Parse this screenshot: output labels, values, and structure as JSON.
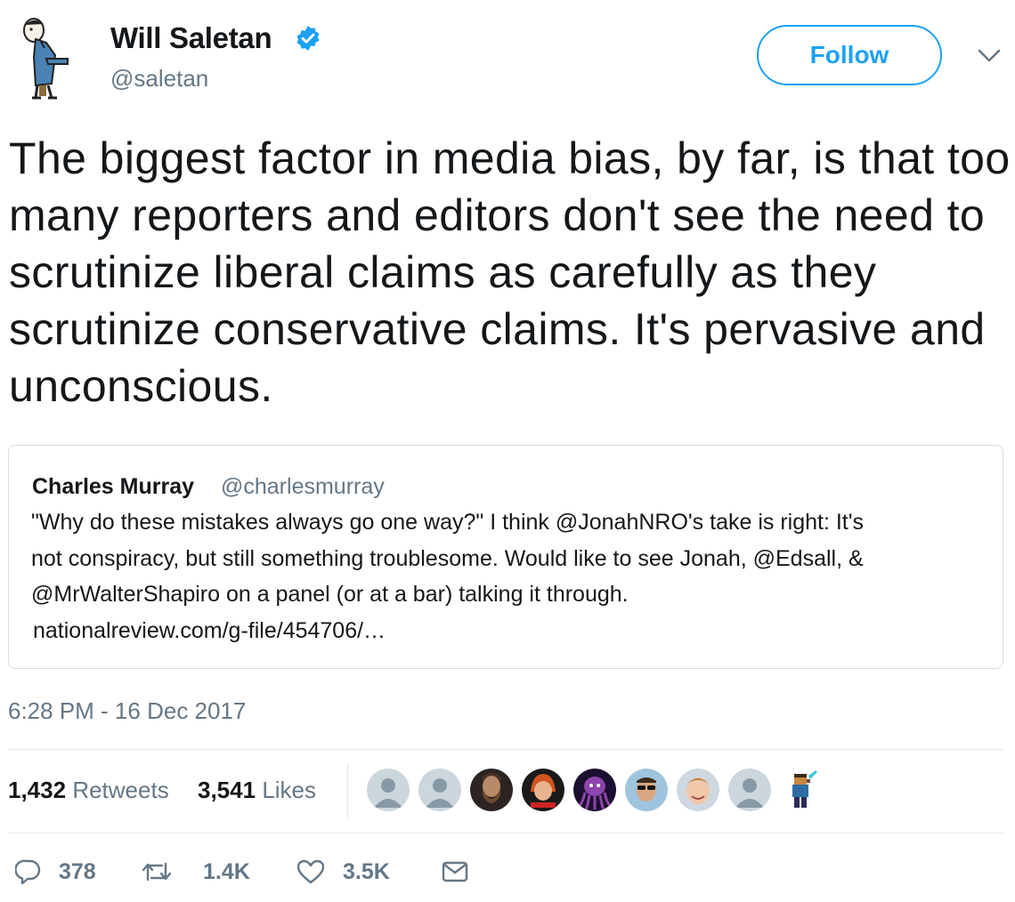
{
  "author": {
    "name": "Will Saletan",
    "handle": "@saletan",
    "verified_icon": "verified-badge-icon",
    "avatar_icon": "cartoon-man-avatar"
  },
  "follow_label": "Follow",
  "tweet_text": "The biggest factor in media bias, by far, is that too many reporters and editors don't see the need to scrutinize liberal claims as carefully as they scrutinize conservative claims. It's pervasive and unconscious.",
  "quoted_tweet": {
    "name": "Charles Murray",
    "handle": "@charlesmurray",
    "lines": [
      "\"Why do these mistakes always go one way?\" I think @JonahNRO's take is right: It's",
      "not conspiracy, but still something troublesome. Would like to see Jonah, @Edsall, &",
      "@MrWalterShapiro on a panel (or at a bar) talking it through."
    ],
    "link": "nationalreview.com/g-file/454706/…"
  },
  "timestamp": "6:28 PM - 16 Dec 2017",
  "stats": {
    "retweets_count": "1,432",
    "retweets_label": "Retweets",
    "likes_count": "3,541",
    "likes_label": "Likes"
  },
  "liker_avatars": [
    "default-avatar",
    "default-avatar",
    "bearded-man-avatar",
    "redhead-avatar",
    "purple-octopus-avatar",
    "sunglasses-man-avatar",
    "smiling-boy-avatar",
    "default-avatar",
    "pixel-character-avatar"
  ],
  "actions": {
    "replies": "378",
    "retweets": "1.4K",
    "likes": "3.5K"
  },
  "colors": {
    "accent": "#1da1f2",
    "muted": "#657786",
    "text": "#14171a",
    "border": "#e1e8ed"
  }
}
